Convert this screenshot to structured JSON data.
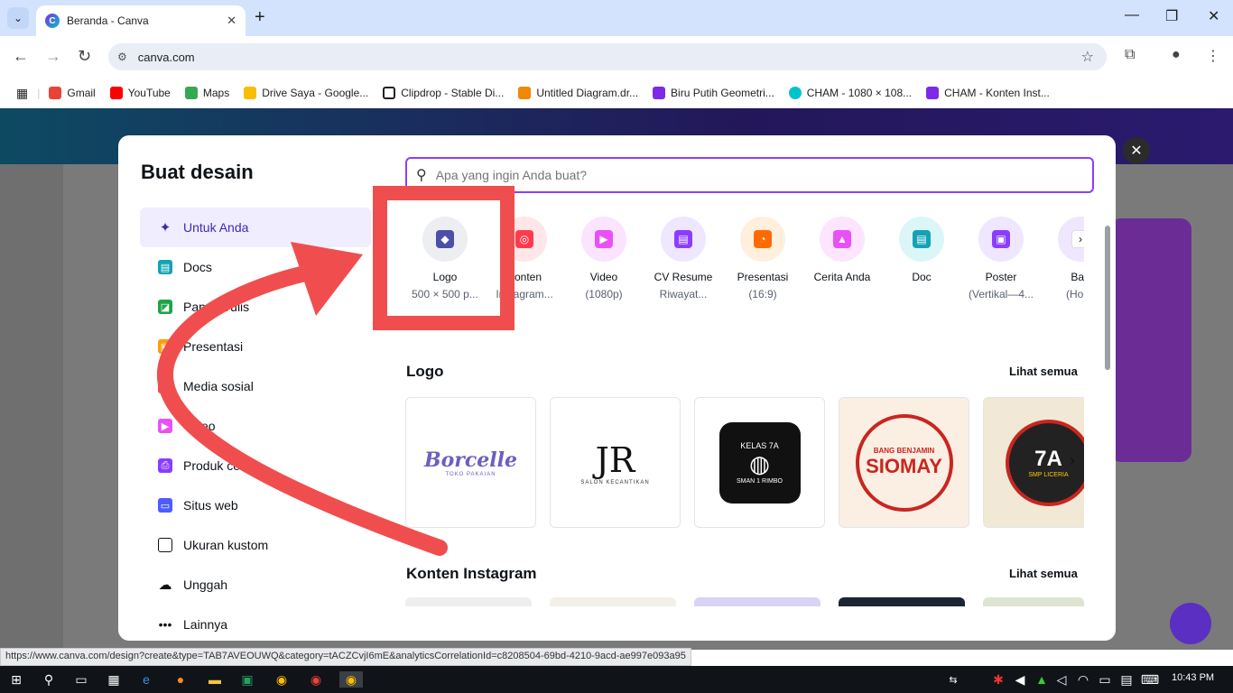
{
  "browser": {
    "tab_title": "Beranda - Canva",
    "url": "canva.com",
    "bookmarks": [
      {
        "label": "Gmail",
        "color": "#ea4335"
      },
      {
        "label": "YouTube",
        "color": "#ff0000"
      },
      {
        "label": "Maps",
        "color": "#34a853"
      },
      {
        "label": "Drive Saya - Google...",
        "color": "#fbbc04"
      },
      {
        "label": "Clipdrop - Stable Di...",
        "color": "#222222"
      },
      {
        "label": "Untitled Diagram.dr...",
        "color": "#f08705"
      },
      {
        "label": "Biru Putih Geometri...",
        "color": "#7d2ae8"
      },
      {
        "label": "CHAM - 1080 × 108...",
        "color": "#00c4cc"
      },
      {
        "label": "CHAM - Konten Inst...",
        "color": "#7d2ae8"
      }
    ]
  },
  "modal": {
    "title": "Buat desain",
    "search_placeholder": "Apa yang ingin Anda buat?",
    "menu": [
      {
        "label": "Untuk Anda",
        "icon": "sparkle-icon",
        "color": "#8b3dff"
      },
      {
        "label": "Docs",
        "icon": "docs-icon",
        "color": "#13a3b5"
      },
      {
        "label": "Papan Tulis",
        "icon": "whiteboard-icon",
        "color": "#1ea446"
      },
      {
        "label": "Presentasi",
        "icon": "presentation-icon",
        "color": "#ff9e0b"
      },
      {
        "label": "Media sosial",
        "icon": "social-media-icon",
        "color": "#ff3b4b"
      },
      {
        "label": "Video",
        "icon": "video-icon",
        "color": "#e950f7"
      },
      {
        "label": "Produk cetak",
        "icon": "print-icon",
        "color": "#8b3dff"
      },
      {
        "label": "Situs web",
        "icon": "website-icon",
        "color": "#4c5cff"
      },
      {
        "label": "Ukuran kustom",
        "icon": "custom-size-icon",
        "color": "#0e1318"
      },
      {
        "label": "Unggah",
        "icon": "upload-icon",
        "color": "#0e1318"
      },
      {
        "label": "Lainnya",
        "icon": "more-icon",
        "color": "#0e1318"
      }
    ],
    "design_types": [
      {
        "label": "Logo",
        "sub": "500 × 500 p...",
        "bg": "#eceef2",
        "color": "#4b4fa8"
      },
      {
        "label": "Konten",
        "sub": "Instagram...",
        "bg": "#ffe6e8",
        "color": "#ff3b4b"
      },
      {
        "label": "Video",
        "sub": "(1080p)",
        "bg": "#fbe4ff",
        "color": "#e950f7"
      },
      {
        "label": "CV Resume",
        "sub": "Riwayat...",
        "bg": "#efe6ff",
        "color": "#8b3dff"
      },
      {
        "label": "Presentasi",
        "sub": "(16:9)",
        "bg": "#ffefdc",
        "color": "#ff6a00"
      },
      {
        "label": "Cerita Anda",
        "sub": "",
        "bg": "#fde4ff",
        "color": "#e950f7"
      },
      {
        "label": "Doc",
        "sub": "",
        "bg": "#dcf6f8",
        "color": "#13a3b5"
      },
      {
        "label": "Poster",
        "sub": "(Vertikal—4...",
        "bg": "#efe6ff",
        "color": "#8b3dff"
      },
      {
        "label": "Ban",
        "sub": "(Horiz",
        "bg": "#efe6ff",
        "color": "#8b3dff"
      }
    ],
    "sections": [
      {
        "title": "Logo",
        "see_all": "Lihat semua"
      },
      {
        "title": "Konten Instagram",
        "see_all": "Lihat semua"
      }
    ],
    "logo_cards": [
      {
        "text": "Borcelle",
        "sub": "TOKO PAKAIAN",
        "bg": "#ffffff",
        "fg": "#6b5fbf"
      },
      {
        "text": "JR",
        "sub": "SALON KECANTIKAN",
        "bg": "#ffffff",
        "fg": "#111111"
      },
      {
        "text": "KELAS 7A",
        "sub": "SMAN 1 RIMBO",
        "bg": "#ffffff",
        "fg": "#111111"
      },
      {
        "text": "SIOMAY",
        "sub": "BANG BENJAMIN",
        "bg": "#fbeee3",
        "fg": "#c8261f"
      },
      {
        "text": "7A",
        "sub": "SMP LICERIA",
        "bg": "#f1e8d6",
        "fg": "#c8261f"
      }
    ]
  },
  "status_url": "https://www.canva.com/design?create&type=TAB7AVEOUWQ&category=tACZCvjI6mE&analyticsCorrelationId=c8208504-69bd-4210-9acd-ae997e093a95",
  "taskbar": {
    "time": "10:43 PM"
  }
}
